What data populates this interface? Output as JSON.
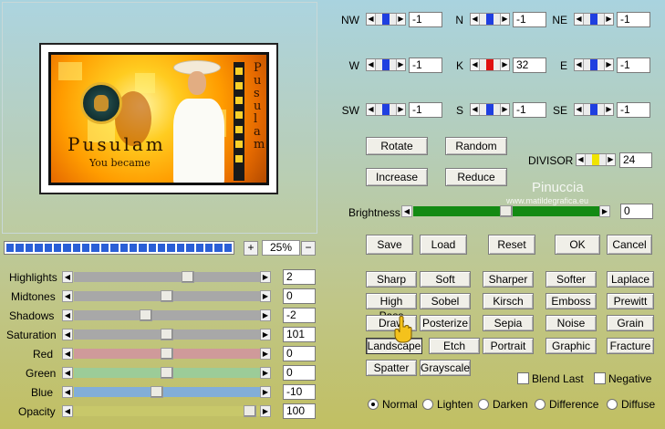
{
  "preview": {
    "art_title": "Pusulam",
    "art_subtitle": "You became",
    "vertical_text": "Pusulam"
  },
  "zoom": {
    "plus": "+",
    "minus": "−",
    "value": "25%",
    "progress_segments": 24
  },
  "sliders": [
    {
      "label": "Highlights",
      "value": "2",
      "position": 0.62,
      "color": "#a8a8a8"
    },
    {
      "label": "Midtones",
      "value": "0",
      "position": 0.5,
      "color": "#a8a8a8"
    },
    {
      "label": "Shadows",
      "value": "-2",
      "position": 0.38,
      "color": "#a8a8a8"
    },
    {
      "label": "Saturation",
      "value": "101",
      "position": 0.5,
      "color": "#a8a8a8"
    },
    {
      "label": "Red",
      "value": "0",
      "position": 0.5,
      "color": "#cf9a9a"
    },
    {
      "label": "Green",
      "value": "0",
      "position": 0.5,
      "color": "#9ccc98"
    },
    {
      "label": "Blue",
      "value": "-10",
      "position": 0.44,
      "color": "#82aed8"
    },
    {
      "label": "Opacity",
      "value": "100",
      "position": 0.98,
      "color": "#c8c86a"
    }
  ],
  "matrix": [
    {
      "label": "NW",
      "value": "-1"
    },
    {
      "label": "N",
      "value": "-1"
    },
    {
      "label": "NE",
      "value": "-1"
    },
    {
      "label": "W",
      "value": "-1"
    },
    {
      "label": "K",
      "value": "32",
      "accent": "#e01010"
    },
    {
      "label": "E",
      "value": "-1"
    },
    {
      "label": "SW",
      "value": "-1"
    },
    {
      "label": "S",
      "value": "-1"
    },
    {
      "label": "SE",
      "value": "-1"
    }
  ],
  "controls": {
    "rotate": "Rotate",
    "random": "Random",
    "increase": "Increase",
    "reduce": "Reduce",
    "divisor_label": "DIVISOR",
    "divisor_value": "24",
    "divisor_accent": "#f0e400",
    "brightness_label": "Brightness",
    "brightness_value": "0",
    "brightness_color": "#138a13",
    "save": "Save",
    "load": "Load",
    "reset": "Reset",
    "ok": "OK",
    "cancel": "Cancel"
  },
  "watermark": {
    "title": "Pinuccia",
    "url": "www.matildegrafica.eu"
  },
  "presets": [
    [
      "Sharp",
      "Soft",
      "Sharper",
      "Softer",
      "Laplace"
    ],
    [
      "High Pass",
      "Sobel",
      "Kirsch",
      "Emboss",
      "Prewitt"
    ],
    [
      "Draw",
      "Posterize",
      "Sepia",
      "Noise",
      "Grain"
    ],
    [
      "Landscape",
      "Etch",
      "Portrait",
      "Graphic",
      "Fracture"
    ],
    [
      "Spatter",
      "Grayscale"
    ]
  ],
  "options": {
    "blend_last": "Blend Last",
    "negative": "Negative"
  },
  "modes": [
    "Normal",
    "Lighten",
    "Darken",
    "Difference",
    "Diffuse"
  ],
  "selected_mode": "Normal",
  "pressed_preset": "Landscape"
}
